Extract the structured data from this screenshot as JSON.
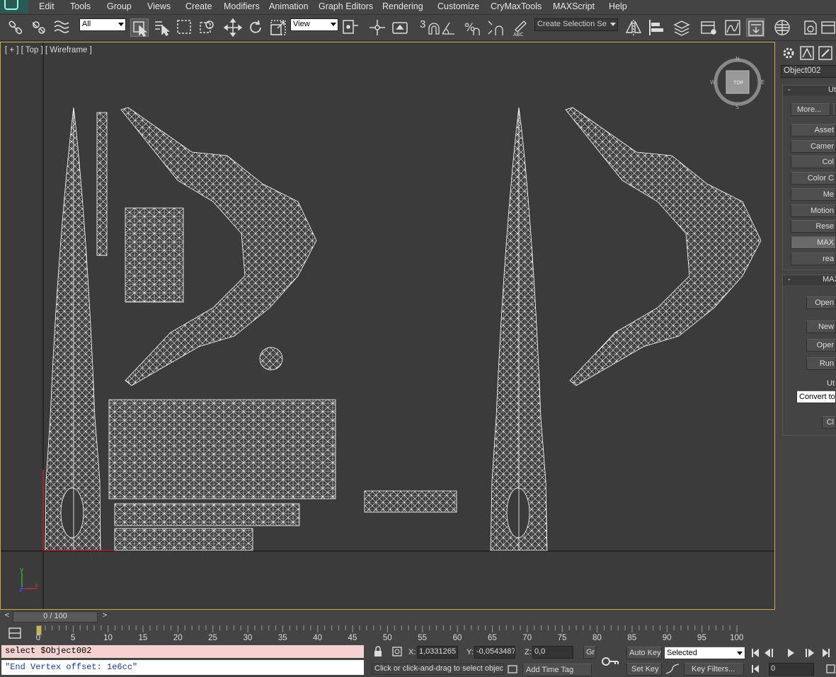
{
  "menu": {
    "items": [
      "Edit",
      "Tools",
      "Group",
      "Views",
      "Create",
      "Modifiers",
      "Animation",
      "Graph Editors",
      "Rendering",
      "Customize",
      "CryMaxTools",
      "MAXScript",
      "Help"
    ]
  },
  "toolbar": {
    "selection_filter": "All",
    "reference_coord": "View",
    "snap_number": "3",
    "named_selection_placeholder": "Create Selection Se",
    "icons": [
      "link-icon",
      "unlink-icon",
      "bind-space-warp-icon",
      "select-object-icon",
      "select-by-name-icon",
      "rectangular-selection-icon",
      "window-crossing-icon",
      "move-icon",
      "rotate-icon",
      "scale-icon",
      "use-pivot-icon",
      "select-and-manipulate-icon",
      "keyboard-shortcut-icon",
      "snap-icon",
      "angle-snap-icon",
      "percent-snap-icon",
      "spinner-snap-icon",
      "edit-named-selection-icon",
      "mirror-icon",
      "align-icon",
      "layer-manager-icon",
      "graphite-ribbon-icon",
      "curve-editor-icon",
      "schematic-view-icon",
      "material-editor-icon",
      "render-setup-icon",
      "render-frame-icon"
    ]
  },
  "viewport": {
    "label": "[ + ] [ Top ] [ Wireframe ]",
    "viewcube_label": "TOP",
    "compass": {
      "n": "N",
      "s": "S",
      "w": "W",
      "e": "E"
    },
    "axis_y": "y",
    "axis_x": "x",
    "axis_z": "z"
  },
  "command_panel": {
    "tabs": [
      "gear-icon",
      "display-icon",
      "utilities-icon"
    ],
    "object_name": "Object002",
    "utilities_rollout": "Ut",
    "more_button": "More...",
    "utility_buttons": [
      "Asset",
      "Camer",
      "Col",
      "Color C",
      "Me",
      "Motion",
      "Rese",
      "MAX",
      "rea"
    ],
    "active_utility_index": 7,
    "maxscript_rollout": "MAX",
    "maxscript_buttons": [
      "Open",
      "New",
      "Oper",
      "Run"
    ],
    "utilities_label": "Ut",
    "utilities_dropdown": "Convert to",
    "close_button": "Cl"
  },
  "timeline": {
    "slider_label": "0 / 100",
    "prev_label": "<",
    "next_label": ">",
    "ticks": [
      "0",
      "5",
      "10",
      "15",
      "20",
      "25",
      "30",
      "35",
      "40",
      "45",
      "50",
      "55",
      "60",
      "65",
      "70",
      "75",
      "80",
      "85",
      "90",
      "95",
      "100"
    ]
  },
  "status": {
    "listener_command": "select $Object002",
    "listener_output": "\"End Vertex offset: 1e6cc\"",
    "x_label": "X:",
    "x_value": "1,0331265",
    "y_label": "Y:",
    "y_value": "-0,0543487",
    "z_label": "Z:",
    "z_value": "0,0",
    "grid_label": "Gr",
    "prompt": "Click or click-and-drag to select objects",
    "add_time_tag": "Add Time Tag",
    "auto_key": "Auto Key",
    "set_key": "Set Key",
    "selected": "Selected",
    "key_filters": "Key Filters...",
    "frame": "0"
  }
}
